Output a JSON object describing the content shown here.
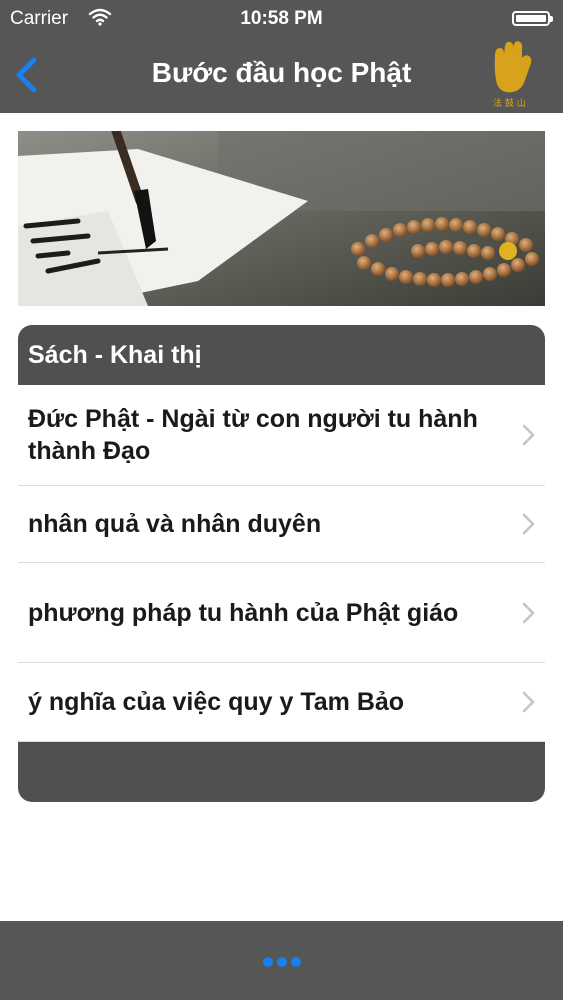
{
  "status_bar": {
    "carrier": "Carrier",
    "time": "10:58 PM"
  },
  "nav": {
    "title": "Bước đầu học Phật",
    "back_icon": "chevron-left-icon",
    "logo_icon": "hand-logo-icon"
  },
  "colors": {
    "bar": "#565656",
    "section": "#505050",
    "accent": "#1a7ff0",
    "logo": "#d9a21c"
  },
  "section": {
    "title": "Sách -  Khai thị"
  },
  "items": [
    {
      "label": "Đức Phật - Ngài từ con người tu hành thành Đạo"
    },
    {
      "label": "nhân quả và nhân duyên"
    },
    {
      "label": "phương pháp tu hành của Phật giáo"
    },
    {
      "label": "ý nghĩa của việc quy y Tam Bảo"
    }
  ],
  "bottom_bar": {
    "icon": "more-dots-icon"
  }
}
